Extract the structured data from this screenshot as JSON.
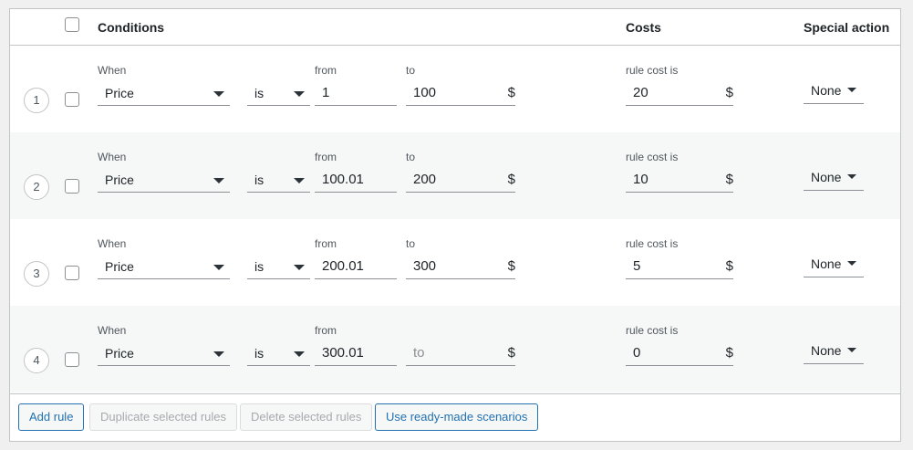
{
  "header": {
    "conditions": "Conditions",
    "costs": "Costs",
    "special_action": "Special action"
  },
  "labels": {
    "when": "When",
    "from": "from",
    "to": "to",
    "rule_cost_is": "rule cost is",
    "currency": "$"
  },
  "rules": [
    {
      "num": "1",
      "when": "Price",
      "op": "is",
      "from": "1",
      "to": "100",
      "cost": "20",
      "action": "None",
      "show_to_label": true
    },
    {
      "num": "2",
      "when": "Price",
      "op": "is",
      "from": "100.01",
      "to": "200",
      "cost": "10",
      "action": "None",
      "show_to_label": true
    },
    {
      "num": "3",
      "when": "Price",
      "op": "is",
      "from": "200.01",
      "to": "300",
      "cost": "5",
      "action": "None",
      "show_to_label": true
    },
    {
      "num": "4",
      "when": "Price",
      "op": "is",
      "from": "300.01",
      "to": "",
      "to_placeholder": "to",
      "cost": "0",
      "action": "None",
      "show_to_label": false
    }
  ],
  "footer": {
    "add_rule": "Add rule",
    "duplicate": "Duplicate selected rules",
    "delete": "Delete selected rules",
    "scenarios": "Use ready-made scenarios"
  },
  "colors": {
    "accent": "#2271b1",
    "border": "#c3c4c7",
    "alt_row": "#f6f7f7"
  }
}
